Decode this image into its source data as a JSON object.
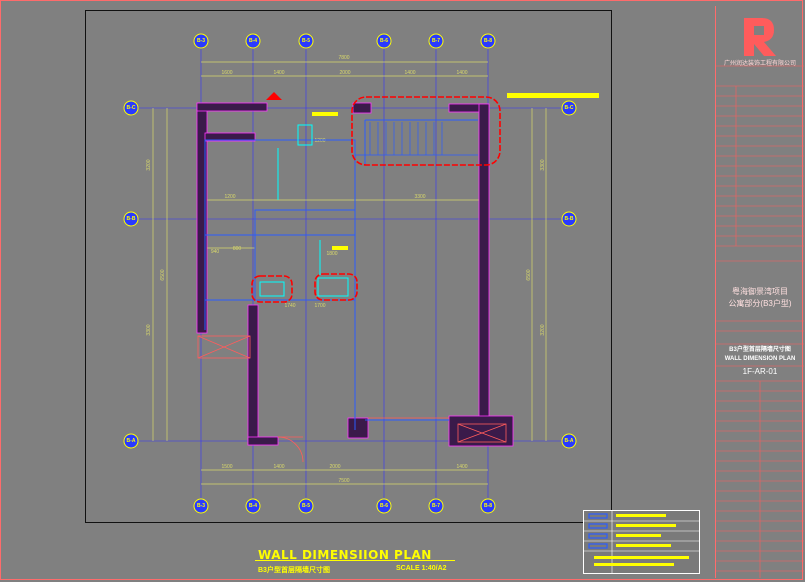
{
  "plan": {
    "title": "WALL DIMENSIION PLAN",
    "subtitle": "B3户型首层隔墙尺寸图",
    "scale": "SCALE 1:40/A2"
  },
  "top_axes": [
    "B-3",
    "B-4",
    "B-5",
    "B-6",
    "B-7",
    "B-8"
  ],
  "bottom_axes": [
    "B-3",
    "B-4",
    "B-5",
    "B-6",
    "B-7",
    "B-8"
  ],
  "left_axes": [
    "B-C",
    "B-B",
    "B-A"
  ],
  "right_axes": [
    "B-C",
    "B-B",
    "B-A"
  ],
  "top_total_dim": "7800",
  "top_dims": [
    "1600",
    "1400",
    "2000",
    "1400",
    "1400"
  ],
  "bottom_total_dim": "7500",
  "bottom_dims": [
    "1500",
    "1400",
    "2000",
    "1400"
  ],
  "left_total_dim": "6500",
  "left_dims": [
    "3200",
    "3300"
  ],
  "right_total_dim": "6500",
  "right_dims": [
    "3300",
    "3200"
  ],
  "inner_dims": [
    "1200",
    "3300",
    "1200",
    "1740",
    "1700",
    "1800",
    "940",
    "800"
  ],
  "colors": {
    "wall": "#3a1a4a",
    "wall_outline": "#ff33ff",
    "dimension": "#d9d96a",
    "axis_bubble": "#ffff00",
    "axis_line": "#3333ff",
    "revision_cloud": "#ff0000",
    "cyan_detail": "#00ffff"
  },
  "title_block": {
    "company": "广州润达装饰工程有限公司",
    "project_name": "粤海御景湾项目",
    "project_part": "公寓部分(B3户型)",
    "drawing_name_cn": "B3户型首层隔墙尺寸图",
    "drawing_name_en": "WALL DIMENSION PLAN",
    "drawing_code": "1F-AR-01"
  }
}
